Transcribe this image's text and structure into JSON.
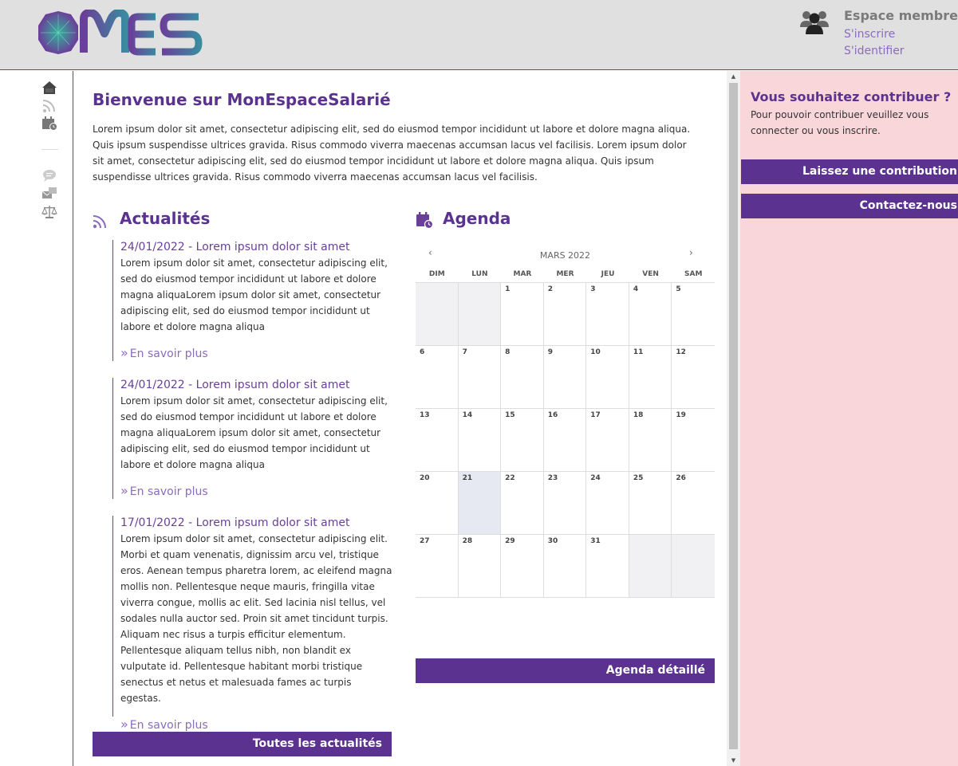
{
  "header": {
    "logo_text": "MES",
    "member": {
      "title": "Espace membre",
      "register": "S'inscrire",
      "login": "S'identifier"
    }
  },
  "sidebar_icons": [
    "home-icon",
    "rss-icon",
    "calendar-icon",
    "chat-icon",
    "mail-icon",
    "balance-icon"
  ],
  "main": {
    "welcome_title": "Bienvenue sur MonEspaceSalarié",
    "welcome_text": "Lorem ipsum dolor sit amet, consectetur adipiscing elit, sed do eiusmod tempor incididunt ut labore et dolore magna aliqua. Quis ipsum suspendisse ultrices gravida. Risus commodo viverra maecenas accumsan lacus vel facilisis. Lorem ipsum dolor sit amet, consectetur adipiscing elit, sed do eiusmod tempor incididunt ut labore et dolore magna aliqua. Quis ipsum suspendisse ultrices gravida. Risus commodo viverra maecenas accumsan lacus vel facilisis.",
    "news": {
      "title": "Actualités",
      "items": [
        {
          "headline": "24/01/2022 - Lorem ipsum dolor sit amet",
          "body": "Lorem ipsum dolor sit amet, consectetur adipiscing elit, sed do eiusmod tempor incididunt ut labore et dolore magna aliquaLorem ipsum dolor sit amet, consectetur adipiscing elit, sed do eiusmod tempor incididunt ut labore et dolore magna aliqua",
          "more": "En savoir plus"
        },
        {
          "headline": "24/01/2022 - Lorem ipsum dolor sit amet",
          "body": "Lorem ipsum dolor sit amet, consectetur adipiscing elit, sed do eiusmod tempor incididunt ut labore et dolore magna aliquaLorem ipsum dolor sit amet, consectetur adipiscing elit, sed do eiusmod tempor incididunt ut labore et dolore magna aliqua",
          "more": "En savoir plus"
        },
        {
          "headline": "17/01/2022 - Lorem ipsum dolor sit amet",
          "body": "Lorem ipsum dolor sit amet, consectetur adipiscing elit. Morbi et quam venenatis, dignissim arcu vel, tristique eros. Aenean tempus pharetra lorem, ac eleifend magna mollis non. Pellentesque neque mauris, fringilla vitae viverra congue, mollis ac elit. Sed lacinia nisl tellus, vel sodales nulla auctor sed. Proin sit amet tincidunt turpis. Aliquam nec risus a turpis efficitur elementum. Pellentesque aliquam tellus nibh, non blandit ex vulputate id. Pellentesque habitant morbi tristique senectus et netus et malesuada fames ac turpis egestas.",
          "more": "En savoir plus"
        }
      ],
      "all_button": "Toutes les actualités"
    },
    "agenda": {
      "title": "Agenda",
      "month": "MARS 2022",
      "prev": "‹",
      "next": "›",
      "day_headers": [
        "DIM",
        "LUN",
        "MAR",
        "MER",
        "JEU",
        "VEN",
        "SAM"
      ],
      "weeks": [
        [
          "",
          "",
          "1",
          "2",
          "3",
          "4",
          "5"
        ],
        [
          "6",
          "7",
          "8",
          "9",
          "10",
          "11",
          "12"
        ],
        [
          "13",
          "14",
          "15",
          "16",
          "17",
          "18",
          "19"
        ],
        [
          "20",
          "21",
          "22",
          "23",
          "24",
          "25",
          "26"
        ],
        [
          "27",
          "28",
          "29",
          "30",
          "31",
          "",
          ""
        ]
      ],
      "today": "21",
      "detail_button": "Agenda détaillé"
    }
  },
  "right_panel": {
    "title": "Vous souhaitez contribuer ?",
    "text": "Pour pouvoir contribuer veuillez vous connecter ou vous inscrire.",
    "contribution_button": "Laissez une contribution",
    "contact_button": "Contactez-nous"
  },
  "colors": {
    "brand": "#5b3290",
    "link": "#8b6bbb",
    "header_bg": "#e0e0e0",
    "right_bg": "#f9d6da"
  }
}
